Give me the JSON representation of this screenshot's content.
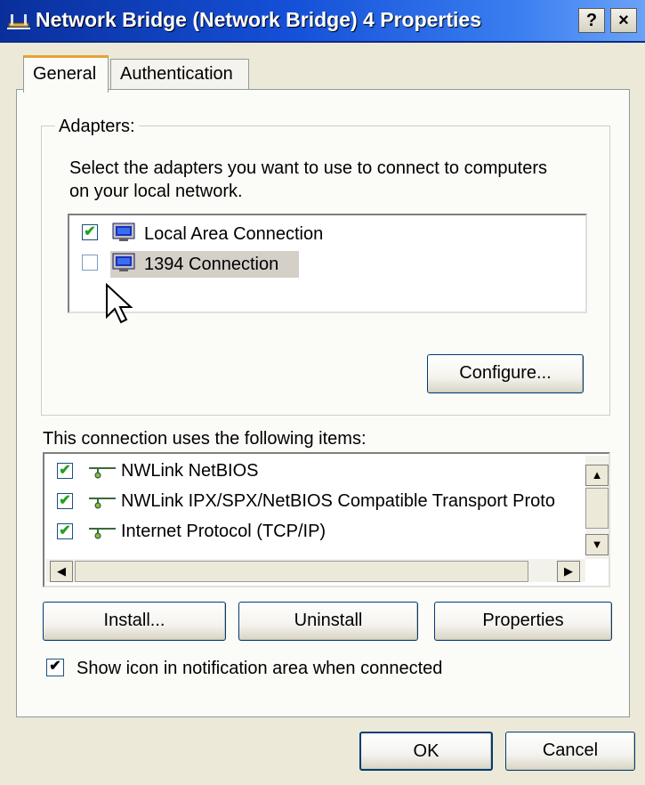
{
  "window": {
    "title": "Network Bridge (Network Bridge) 4 Properties",
    "help_button": "?",
    "close_button": "×"
  },
  "tabs": [
    {
      "label": "General",
      "active": true
    },
    {
      "label": "Authentication",
      "active": false
    }
  ],
  "adapters": {
    "group_label": "Adapters:",
    "description_line1": "Select the adapters you want to use to connect to computers",
    "description_line2": "on your local network.",
    "items": [
      {
        "label": "Local Area Connection",
        "checked": true
      },
      {
        "label": "1394 Connection",
        "checked": false,
        "highlighted": true
      }
    ],
    "configure_label": "Configure..."
  },
  "items_section": {
    "label": "This connection uses the following items:",
    "items": [
      {
        "label": "NWLink NetBIOS",
        "checked": true
      },
      {
        "label": "NWLink IPX/SPX/NetBIOS Compatible Transport Proto",
        "checked": true
      },
      {
        "label": "Internet Protocol (TCP/IP)",
        "checked": true
      }
    ],
    "install_label": "Install...",
    "uninstall_label": "Uninstall",
    "properties_label": "Properties"
  },
  "notification": {
    "label": "Show icon in notification area when connected",
    "checked": true
  },
  "footer": {
    "ok_label": "OK",
    "cancel_label": "Cancel"
  },
  "colors": {
    "titlebar": "#0a2f9b",
    "dialog_bg": "#ece9d8",
    "panel_bg": "#fbfbf8",
    "highlight": "#d4d0c8",
    "check": "#21a121"
  }
}
